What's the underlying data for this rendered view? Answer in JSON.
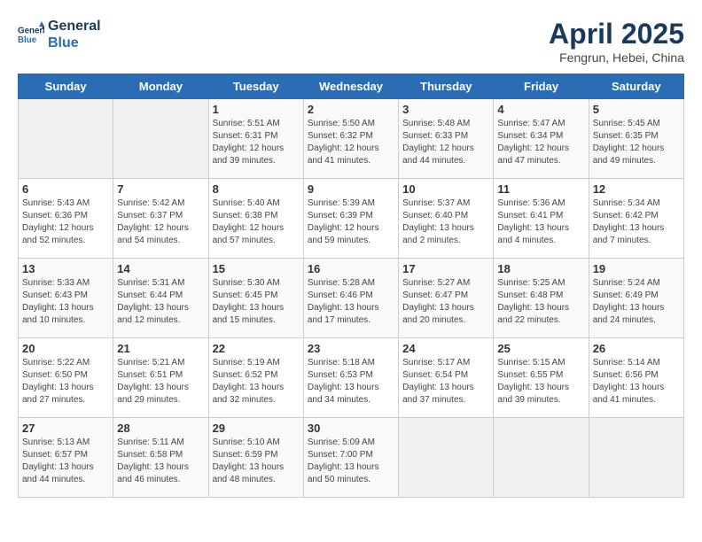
{
  "header": {
    "logo_line1": "General",
    "logo_line2": "Blue",
    "month_title": "April 2025",
    "location": "Fengrun, Hebei, China"
  },
  "days_of_week": [
    "Sunday",
    "Monday",
    "Tuesday",
    "Wednesday",
    "Thursday",
    "Friday",
    "Saturday"
  ],
  "weeks": [
    [
      {
        "day": "",
        "sunrise": "",
        "sunset": "",
        "daylight": "",
        "empty": true
      },
      {
        "day": "",
        "sunrise": "",
        "sunset": "",
        "daylight": "",
        "empty": true
      },
      {
        "day": "1",
        "sunrise": "Sunrise: 5:51 AM",
        "sunset": "Sunset: 6:31 PM",
        "daylight": "Daylight: 12 hours and 39 minutes."
      },
      {
        "day": "2",
        "sunrise": "Sunrise: 5:50 AM",
        "sunset": "Sunset: 6:32 PM",
        "daylight": "Daylight: 12 hours and 41 minutes."
      },
      {
        "day": "3",
        "sunrise": "Sunrise: 5:48 AM",
        "sunset": "Sunset: 6:33 PM",
        "daylight": "Daylight: 12 hours and 44 minutes."
      },
      {
        "day": "4",
        "sunrise": "Sunrise: 5:47 AM",
        "sunset": "Sunset: 6:34 PM",
        "daylight": "Daylight: 12 hours and 47 minutes."
      },
      {
        "day": "5",
        "sunrise": "Sunrise: 5:45 AM",
        "sunset": "Sunset: 6:35 PM",
        "daylight": "Daylight: 12 hours and 49 minutes."
      }
    ],
    [
      {
        "day": "6",
        "sunrise": "Sunrise: 5:43 AM",
        "sunset": "Sunset: 6:36 PM",
        "daylight": "Daylight: 12 hours and 52 minutes."
      },
      {
        "day": "7",
        "sunrise": "Sunrise: 5:42 AM",
        "sunset": "Sunset: 6:37 PM",
        "daylight": "Daylight: 12 hours and 54 minutes."
      },
      {
        "day": "8",
        "sunrise": "Sunrise: 5:40 AM",
        "sunset": "Sunset: 6:38 PM",
        "daylight": "Daylight: 12 hours and 57 minutes."
      },
      {
        "day": "9",
        "sunrise": "Sunrise: 5:39 AM",
        "sunset": "Sunset: 6:39 PM",
        "daylight": "Daylight: 12 hours and 59 minutes."
      },
      {
        "day": "10",
        "sunrise": "Sunrise: 5:37 AM",
        "sunset": "Sunset: 6:40 PM",
        "daylight": "Daylight: 13 hours and 2 minutes."
      },
      {
        "day": "11",
        "sunrise": "Sunrise: 5:36 AM",
        "sunset": "Sunset: 6:41 PM",
        "daylight": "Daylight: 13 hours and 4 minutes."
      },
      {
        "day": "12",
        "sunrise": "Sunrise: 5:34 AM",
        "sunset": "Sunset: 6:42 PM",
        "daylight": "Daylight: 13 hours and 7 minutes."
      }
    ],
    [
      {
        "day": "13",
        "sunrise": "Sunrise: 5:33 AM",
        "sunset": "Sunset: 6:43 PM",
        "daylight": "Daylight: 13 hours and 10 minutes."
      },
      {
        "day": "14",
        "sunrise": "Sunrise: 5:31 AM",
        "sunset": "Sunset: 6:44 PM",
        "daylight": "Daylight: 13 hours and 12 minutes."
      },
      {
        "day": "15",
        "sunrise": "Sunrise: 5:30 AM",
        "sunset": "Sunset: 6:45 PM",
        "daylight": "Daylight: 13 hours and 15 minutes."
      },
      {
        "day": "16",
        "sunrise": "Sunrise: 5:28 AM",
        "sunset": "Sunset: 6:46 PM",
        "daylight": "Daylight: 13 hours and 17 minutes."
      },
      {
        "day": "17",
        "sunrise": "Sunrise: 5:27 AM",
        "sunset": "Sunset: 6:47 PM",
        "daylight": "Daylight: 13 hours and 20 minutes."
      },
      {
        "day": "18",
        "sunrise": "Sunrise: 5:25 AM",
        "sunset": "Sunset: 6:48 PM",
        "daylight": "Daylight: 13 hours and 22 minutes."
      },
      {
        "day": "19",
        "sunrise": "Sunrise: 5:24 AM",
        "sunset": "Sunset: 6:49 PM",
        "daylight": "Daylight: 13 hours and 24 minutes."
      }
    ],
    [
      {
        "day": "20",
        "sunrise": "Sunrise: 5:22 AM",
        "sunset": "Sunset: 6:50 PM",
        "daylight": "Daylight: 13 hours and 27 minutes."
      },
      {
        "day": "21",
        "sunrise": "Sunrise: 5:21 AM",
        "sunset": "Sunset: 6:51 PM",
        "daylight": "Daylight: 13 hours and 29 minutes."
      },
      {
        "day": "22",
        "sunrise": "Sunrise: 5:19 AM",
        "sunset": "Sunset: 6:52 PM",
        "daylight": "Daylight: 13 hours and 32 minutes."
      },
      {
        "day": "23",
        "sunrise": "Sunrise: 5:18 AM",
        "sunset": "Sunset: 6:53 PM",
        "daylight": "Daylight: 13 hours and 34 minutes."
      },
      {
        "day": "24",
        "sunrise": "Sunrise: 5:17 AM",
        "sunset": "Sunset: 6:54 PM",
        "daylight": "Daylight: 13 hours and 37 minutes."
      },
      {
        "day": "25",
        "sunrise": "Sunrise: 5:15 AM",
        "sunset": "Sunset: 6:55 PM",
        "daylight": "Daylight: 13 hours and 39 minutes."
      },
      {
        "day": "26",
        "sunrise": "Sunrise: 5:14 AM",
        "sunset": "Sunset: 6:56 PM",
        "daylight": "Daylight: 13 hours and 41 minutes."
      }
    ],
    [
      {
        "day": "27",
        "sunrise": "Sunrise: 5:13 AM",
        "sunset": "Sunset: 6:57 PM",
        "daylight": "Daylight: 13 hours and 44 minutes."
      },
      {
        "day": "28",
        "sunrise": "Sunrise: 5:11 AM",
        "sunset": "Sunset: 6:58 PM",
        "daylight": "Daylight: 13 hours and 46 minutes."
      },
      {
        "day": "29",
        "sunrise": "Sunrise: 5:10 AM",
        "sunset": "Sunset: 6:59 PM",
        "daylight": "Daylight: 13 hours and 48 minutes."
      },
      {
        "day": "30",
        "sunrise": "Sunrise: 5:09 AM",
        "sunset": "Sunset: 7:00 PM",
        "daylight": "Daylight: 13 hours and 50 minutes."
      },
      {
        "day": "",
        "sunrise": "",
        "sunset": "",
        "daylight": "",
        "empty": true
      },
      {
        "day": "",
        "sunrise": "",
        "sunset": "",
        "daylight": "",
        "empty": true
      },
      {
        "day": "",
        "sunrise": "",
        "sunset": "",
        "daylight": "",
        "empty": true
      }
    ]
  ]
}
